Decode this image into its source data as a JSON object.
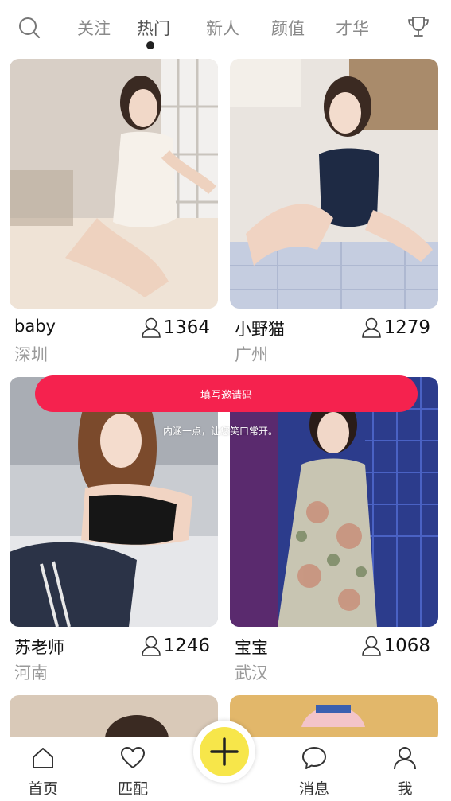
{
  "header": {
    "search_icon": "search-icon",
    "tabs": [
      {
        "label": "关注"
      },
      {
        "label": "热门",
        "active": true
      },
      {
        "label": "新人"
      },
      {
        "label": "颜值"
      },
      {
        "label": "才华"
      }
    ],
    "trophy_icon": "trophy-icon"
  },
  "cards": [
    {
      "name": "baby",
      "city": "深圳",
      "likes": "1364"
    },
    {
      "name": "小野猫",
      "city": "广州",
      "likes": "1279"
    },
    {
      "name": "苏老师",
      "city": "河南",
      "likes": "1246"
    },
    {
      "name": "宝宝",
      "city": "武汉",
      "likes": "1068"
    }
  ],
  "overlay": {
    "invite_label": "填写邀请码",
    "tagline": "内涵一点，让您笑口常开。"
  },
  "bottom_nav": {
    "items": [
      {
        "label": "首页",
        "icon": "home-icon"
      },
      {
        "label": "匹配",
        "icon": "heart-icon"
      },
      {
        "label": "消息",
        "icon": "chat-icon"
      },
      {
        "label": "我",
        "icon": "profile-icon"
      }
    ],
    "center_icon": "plus-icon"
  },
  "colors": {
    "accent": "#f5224e",
    "plus_button": "#f7e64a",
    "muted_text": "#9a9a9a"
  }
}
